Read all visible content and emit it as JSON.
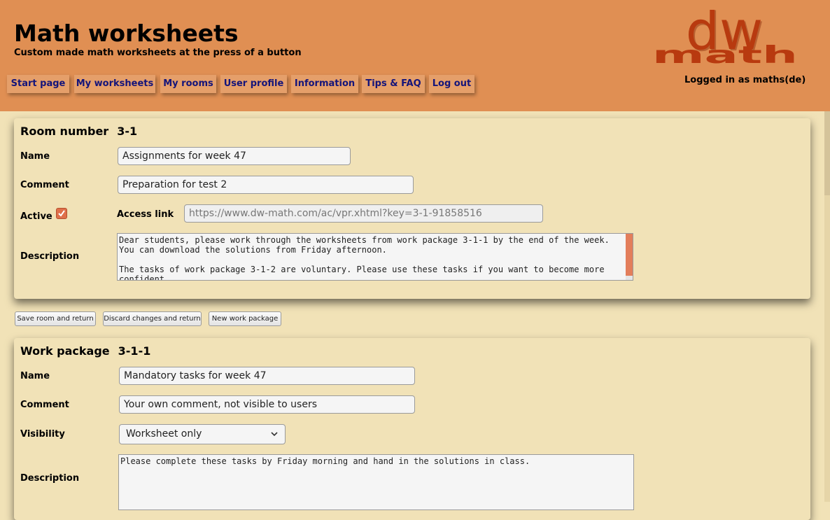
{
  "header": {
    "title": "Math worksheets",
    "subtitle": "Custom made math worksheets at the press of a button",
    "logo_top": "dw",
    "logo_bottom": "math",
    "logged_in": "Logged in as maths(de)"
  },
  "nav": {
    "items": [
      "Start page",
      "My worksheets",
      "My rooms",
      "User profile",
      "Information",
      "Tips & FAQ",
      "Log out"
    ]
  },
  "colors": {
    "header_bg": "#e08f53",
    "page_bg": "#f1e2b7",
    "nav_text": "#14147a",
    "logo": "#b83a0f",
    "checkbox": "#df6f4a"
  },
  "room": {
    "heading": "Room number",
    "number": "3-1",
    "name_label": "Name",
    "name_value": "Assignments for week 47",
    "comment_label": "Comment",
    "comment_value": "Preparation for test 2",
    "active_label": "Active",
    "active_checked": true,
    "access_link_label": "Access link",
    "access_link_value": "https://www.dw-math.com/ac/vpr.xhtml?key=3-1-91858516",
    "description_label": "Description",
    "description_value": "Dear students, please work through the worksheets from work package 3-1-1 by the end of the week.\nYou can download the solutions from Friday afternoon.\n\nThe tasks of work package 3-1-2 are voluntary. Please use these tasks if you want to become more\nconfident."
  },
  "buttons": {
    "save": "Save room and return",
    "discard": "Discard changes and return",
    "new_package": "New work package"
  },
  "work_package": {
    "heading": "Work package",
    "number": "3-1-1",
    "name_label": "Name",
    "name_value": "Mandatory tasks for week 47",
    "comment_label": "Comment",
    "comment_value": "Your own comment, not visible to users",
    "visibility_label": "Visibility",
    "visibility_value": "Worksheet only",
    "description_label": "Description",
    "description_value": "Please complete these tasks by Friday morning and hand in the solutions in class."
  }
}
